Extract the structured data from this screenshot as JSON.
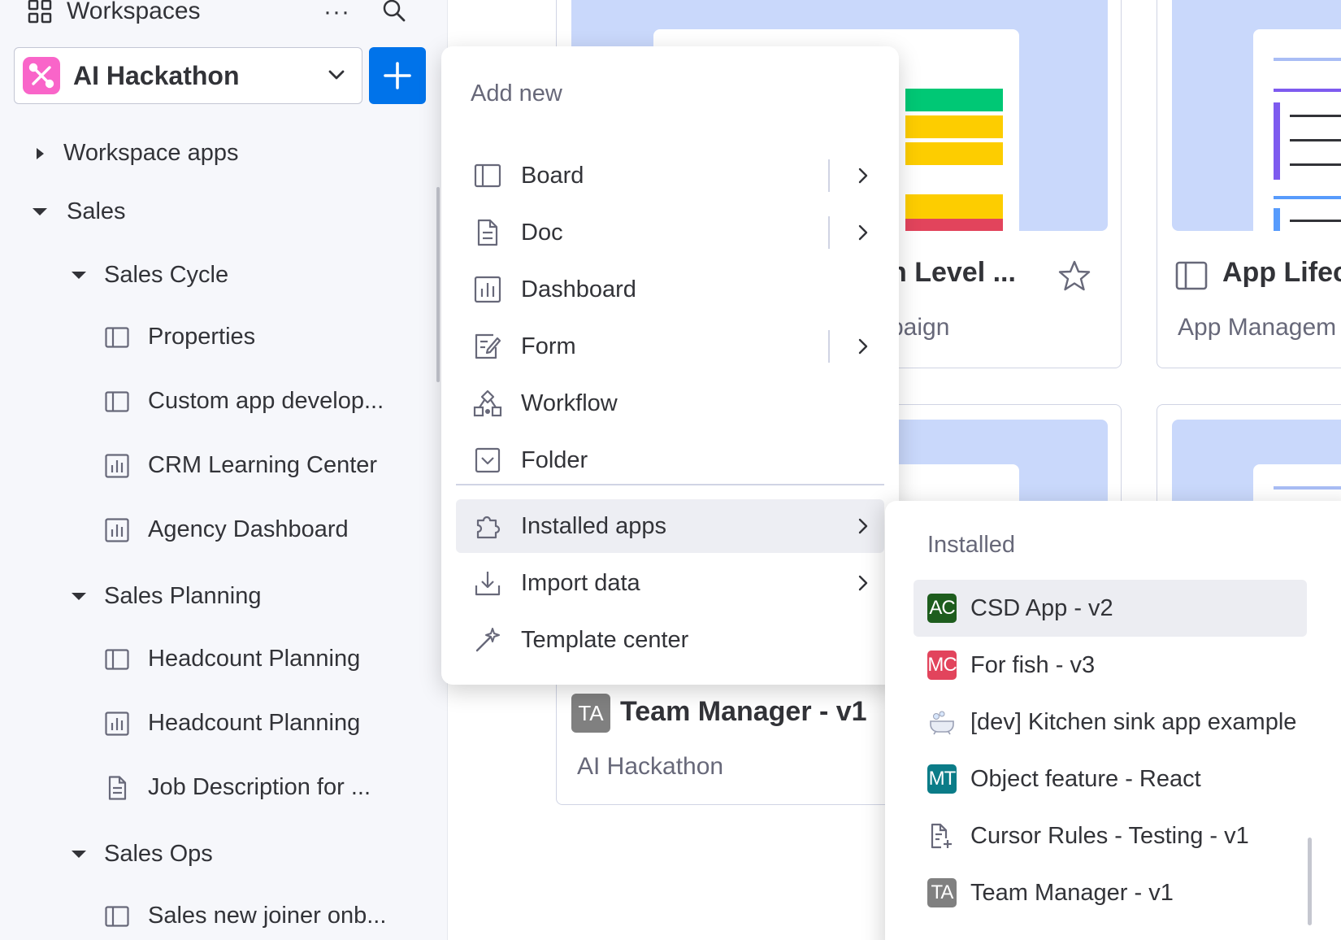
{
  "colors": {
    "brand_blue": "#0073ea",
    "workspace_logo": "#f965c9",
    "badge_ac": "#1e5d1e",
    "badge_mc": "#e2445c",
    "badge_mt": "#0b7c88",
    "badge_ta": "#808080"
  },
  "sidebar": {
    "header_title": "Workspaces",
    "workspace_name": "AI Hackathon",
    "tree": {
      "workspace_apps": "Workspace apps",
      "sales": "Sales",
      "sales_cycle": "Sales Cycle",
      "properties": "Properties",
      "custom_app": "Custom app develop...",
      "crm_learning": "CRM Learning Center",
      "agency_dashboard": "Agency Dashboard",
      "sales_planning": "Sales Planning",
      "headcount_board": "Headcount Planning",
      "headcount_dashboard": "Headcount Planning",
      "job_description": "Job Description for ...",
      "sales_ops": "Sales Ops",
      "sales_new_joiner": "Sales new joiner onb..."
    }
  },
  "cards": {
    "card1_title": "h Level ...",
    "card1_sub": "paign",
    "card2_title": "App Lifec",
    "card2_sub": "App Managem",
    "card3_badge": "TA",
    "card3_title": "Team Manager - v1",
    "card3_sub": "AI Hackathon"
  },
  "add_menu": {
    "header": "Add new",
    "items": [
      {
        "label": "Board",
        "icon": "board-icon"
      },
      {
        "label": "Doc",
        "icon": "doc-icon"
      },
      {
        "label": "Dashboard",
        "icon": "dashboard-icon"
      },
      {
        "label": "Form",
        "icon": "form-icon"
      },
      {
        "label": "Workflow",
        "icon": "workflow-icon"
      },
      {
        "label": "Folder",
        "icon": "folder-icon"
      }
    ],
    "bottom_items": [
      {
        "label": "Installed apps",
        "icon": "puzzle-icon"
      },
      {
        "label": "Import data",
        "icon": "import-icon"
      },
      {
        "label": "Template center",
        "icon": "template-icon"
      }
    ]
  },
  "installed_menu": {
    "header": "Installed",
    "apps": [
      {
        "badge": "AC",
        "label": "CSD App - v2"
      },
      {
        "badge": "MC",
        "label": "For fish - v3"
      },
      {
        "badge": "",
        "label": "[dev] Kitchen sink app example"
      },
      {
        "badge": "MT",
        "label": "Object feature - React"
      },
      {
        "badge": "",
        "label": "Cursor Rules - Testing - v1"
      },
      {
        "badge": "TA",
        "label": "Team Manager - v1"
      }
    ]
  }
}
